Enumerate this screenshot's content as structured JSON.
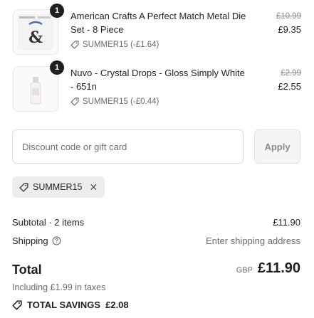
{
  "line_items": [
    {
      "title": "American Crafts A Perfect Match Metal Die Set - 8 Piece",
      "quantity": "1",
      "original_price": "£10.99",
      "price": "£9.35",
      "discount": "SUMMER15 (-£1.64)",
      "thumb_text": "&"
    },
    {
      "title": "Nuvo - Crystal Drops - Gloss Simply White - 651n",
      "quantity": "1",
      "original_price": "£2.99",
      "price": "£2.55",
      "discount": "SUMMER15 (-£0.44)"
    }
  ],
  "discount_form": {
    "placeholder": "Discount code or gift card",
    "apply_label": "Apply"
  },
  "applied_code": "SUMMER15",
  "summary": {
    "subtotal_label": "Subtotal · 2 items",
    "subtotal_value": "£11.90",
    "shipping_label": "Shipping",
    "shipping_value": "Enter shipping address",
    "total_label": "Total",
    "currency": "GBP",
    "total_value": "£11.90",
    "taxes_note": "Including £1.99 in taxes",
    "savings_label": "TOTAL SAVINGS",
    "savings_value": "£2.08"
  },
  "colors": {
    "text": "#1f1f1f",
    "muted": "#6b6b6b",
    "badge": "#1f1f1f",
    "chip_bg": "#ededed"
  }
}
